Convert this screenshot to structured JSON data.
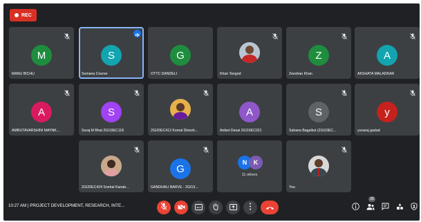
{
  "recording": {
    "label": "REC"
  },
  "tiles": [
    {
      "name": "MANU BICHU",
      "initial": "M",
      "color": "#1e8e3e"
    },
    {
      "name": "Sumana Course",
      "initial": "S",
      "color": "#12a4af"
    },
    {
      "name": "OTTC DANDELI",
      "initial": "G",
      "color": "#1e8e3e"
    },
    {
      "name": "Khan Tangod"
    },
    {
      "name": "Zeeshan Khan",
      "initial": "Z",
      "color": "#1e8e3e"
    },
    {
      "name": "AKSHATA MALADKAR",
      "initial": "A",
      "color": "#12a4af"
    },
    {
      "name": "AMRUTAVARSHINI MAYNK...",
      "initial": "A",
      "color": "#d81b60"
    },
    {
      "name": "Suraj M Bhat 2GI19EC118",
      "initial": "S",
      "color": "#a142f4"
    },
    {
      "name": "2GI20EC412 Komal Dinesh...",
      "initial": ""
    },
    {
      "name": "Aniket Desai 2GI19EC021",
      "initial": "A",
      "color": "#8e58c9"
    },
    {
      "name": "Sahana Bagalkot (2GI19EC...",
      "initial": "S",
      "color": "#5f6368"
    },
    {
      "name": "yuvaraj gadad",
      "initial": "y",
      "color": "#c5221f"
    },
    {
      "name": "2GI20EC424 Snehal Kanab...",
      "initial": ""
    },
    {
      "name": "GANDHALI BARVE - 2GI19...",
      "initial": "G",
      "color": "#1a73e8"
    },
    {
      "name": "11 others",
      "avatars": [
        "N",
        "K"
      ]
    },
    {
      "name": "You"
    }
  ],
  "bottom": {
    "time_label": "10:27 AM",
    "separator": "|",
    "meeting_title": "PROJECT DEVELOPMENT, RESEARCH, INTE...",
    "participants_count": "28"
  },
  "icons": {
    "mic_muted": "mic-off-icon",
    "cam_off": "camera-off-icon",
    "captions": "captions-icon",
    "hand": "raise-hand-icon",
    "present": "present-icon",
    "more": "more-vert-icon",
    "hangup": "call-end-icon",
    "info": "info-icon",
    "people": "people-icon",
    "chat": "chat-icon",
    "activities": "activities-icon",
    "host": "host-controls-icon"
  },
  "colors": {
    "background": "#202124",
    "tile": "#3c4043",
    "danger": "#ea4335",
    "accent": "#8ab4f8"
  }
}
